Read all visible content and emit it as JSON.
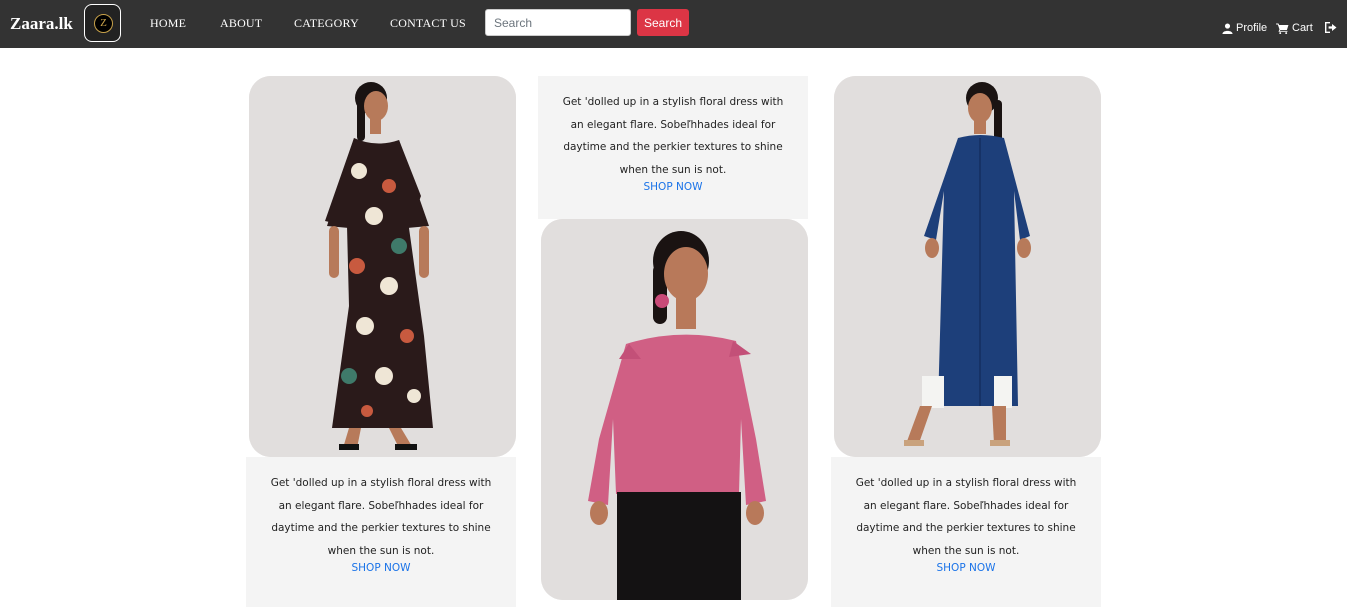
{
  "nav": {
    "brand": "Zaara.lk",
    "logo_letter": "Z",
    "links": [
      "HOME",
      "ABOUT",
      "CATEGORY",
      "CONTACT US"
    ],
    "search_placeholder": "Search",
    "search_button": "Search",
    "profile": "Profile",
    "cart": "Cart"
  },
  "products": [
    {
      "description": "Get 'dolled up in a stylish floral dress with an elegant flare. Sobeľhhades ideal for daytime and the perkier textures to shine when the sun is not.",
      "cta": "SHOP NOW",
      "image_alt": "floral-dress-model"
    },
    {
      "description": "Get 'dolled up in a stylish floral dress with an elegant flare. Sobeľhhades ideal for daytime and the perkier textures to shine when the sun is not.",
      "cta": "SHOP NOW",
      "image_alt": "pink-top-model"
    },
    {
      "description": "Get 'dolled up in a stylish floral dress with an elegant flare. Sobeľhhades ideal for daytime and the perkier textures to shine when the sun is not.",
      "cta": "SHOP NOW",
      "image_alt": "navy-kurta-model"
    }
  ],
  "colors": {
    "navbar": "#333333",
    "search_button": "#dc3545",
    "link": "#1a73e8",
    "card_bg": "#f4f4f4"
  }
}
